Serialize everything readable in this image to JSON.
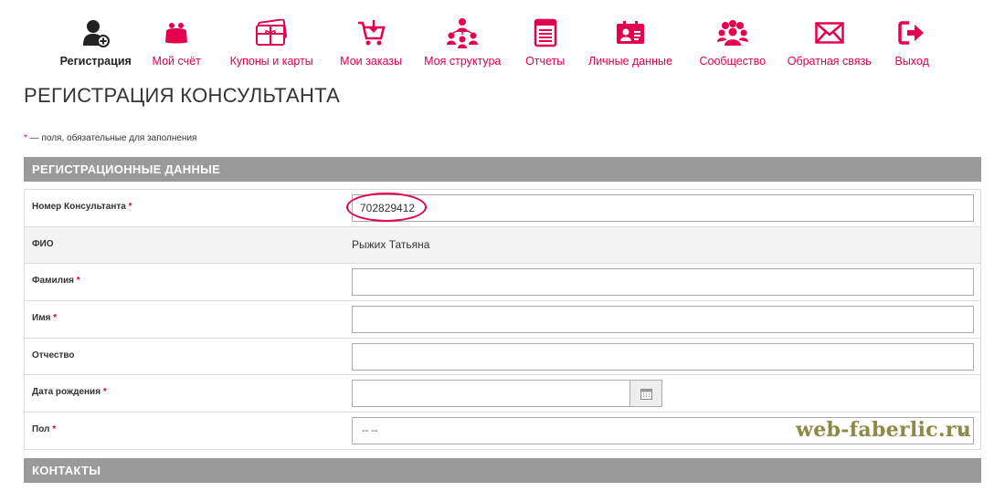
{
  "nav": [
    {
      "label": "Регистрация",
      "icon": "user-plus-icon",
      "active": true
    },
    {
      "label": "Мой счёт",
      "icon": "purse-icon",
      "active": false
    },
    {
      "label": "Купоны и карты",
      "icon": "gift-card-icon",
      "active": false
    },
    {
      "label": "Мои заказы",
      "icon": "cart-icon",
      "active": false
    },
    {
      "label": "Моя структура",
      "icon": "structure-icon",
      "active": false
    },
    {
      "label": "Отчеты",
      "icon": "report-icon",
      "active": false
    },
    {
      "label": "Личные данные",
      "icon": "id-card-icon",
      "active": false
    },
    {
      "label": "Сообщество",
      "icon": "community-icon",
      "active": false
    },
    {
      "label": "Обратная связь",
      "icon": "envelope-icon",
      "active": false
    },
    {
      "label": "Выход",
      "icon": "exit-icon",
      "active": false
    }
  ],
  "page_title": "РЕГИСТРАЦИЯ КОНСУЛЬТАНТА",
  "required_note": {
    "star": "*",
    "text": " — поля, обязательные для заполнения"
  },
  "section_registration": "РЕГИСТРАЦИОННЫЕ ДАННЫЕ",
  "fields": {
    "consultant_number": {
      "label": "Номер Консультанта",
      "value": "702829412"
    },
    "fio": {
      "label": "ФИО",
      "value": "Рыжих Татьяна"
    },
    "last_name": {
      "label": "Фамилия",
      "value": ""
    },
    "first_name": {
      "label": "Имя",
      "value": ""
    },
    "patronymic": {
      "label": "Отчество",
      "value": ""
    },
    "birth_date": {
      "label": "Дата рождения",
      "value": ""
    },
    "gender": {
      "label": "Пол",
      "value": "-- --"
    }
  },
  "required_star": "*",
  "section_contacts": "КОНТАКТЫ",
  "watermark": "web-faberlic.ru",
  "colors": {
    "accent": "#e5004f",
    "section_bar": "#9a9a9a",
    "watermark": "#8d8a45"
  }
}
